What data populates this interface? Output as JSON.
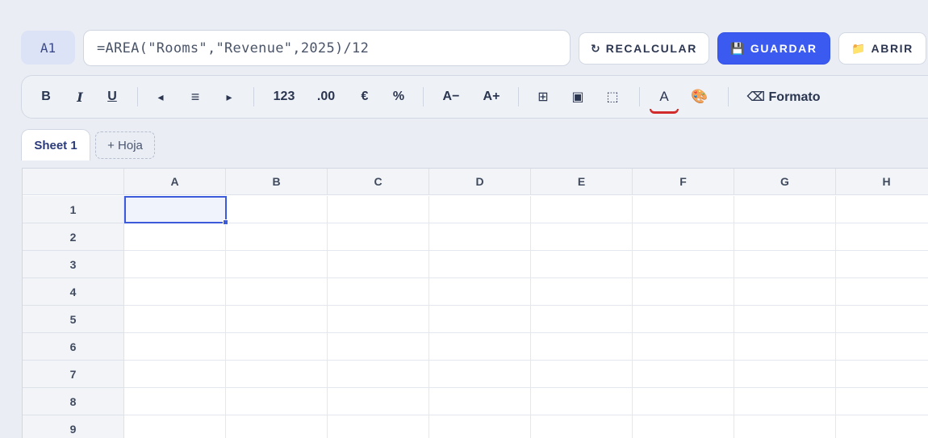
{
  "formula_bar": {
    "cell_reference": "A1",
    "formula": "=AREA(\"Rooms\",\"Revenue\",2025)/12"
  },
  "actions": {
    "recalc": {
      "icon": "refresh-icon",
      "glyph": "↻",
      "label": "RECALCULAR"
    },
    "save": {
      "icon": "floppy-disk-icon",
      "glyph": "💾",
      "label": "GUARDAR"
    },
    "open": {
      "icon": "folder-icon",
      "glyph": "📁",
      "label": "ABRIR"
    }
  },
  "toolbar": {
    "bold": "B",
    "italic": "I",
    "underline": "U",
    "align_left": "◂",
    "align_center": "≡",
    "align_right": "▸",
    "format_number": "123",
    "format_decimal": ".00",
    "format_currency": "€",
    "format_percent": "%",
    "font_smaller": "A−",
    "font_larger": "A+",
    "borders": "⊞",
    "fill_box": "▣",
    "select_box": "⬚",
    "font_color": "A",
    "font_color_value": "#d22b2b",
    "fill_color_icon": "🎨",
    "clear_format": "⌫ Formato"
  },
  "sheets": {
    "active": "Sheet 1",
    "add_label": "+ Hoja"
  },
  "grid": {
    "columns": [
      "A",
      "B",
      "C",
      "D",
      "E",
      "F",
      "G",
      "H"
    ],
    "rows": [
      "1",
      "2",
      "3",
      "4",
      "5",
      "6",
      "7",
      "8",
      "9"
    ],
    "selected_cell": "A1"
  },
  "colors": {
    "accent": "#3b5bf0",
    "selection": "#3b5bdb",
    "background": "#eaeef4"
  }
}
